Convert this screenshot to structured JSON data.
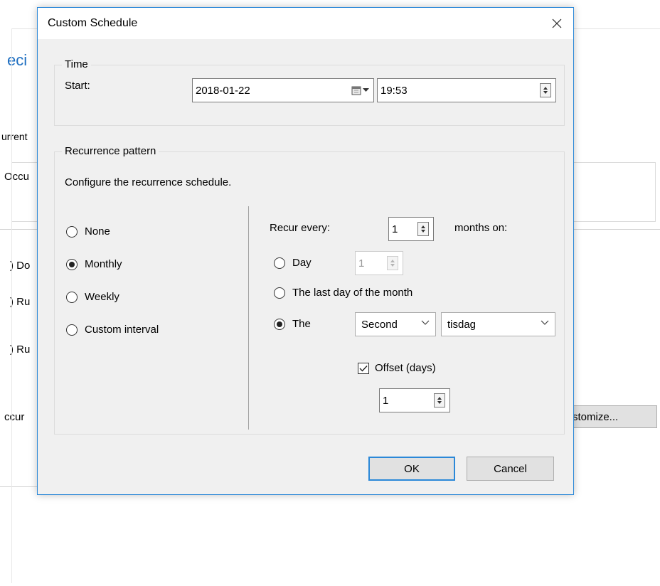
{
  "background": {
    "heading_fragment": "eci",
    "recurrence_fragment": "urrent",
    "occurs_fragment": "Occu",
    "option1": ") Do",
    "option2": ") Ru",
    "option3": ") Ru",
    "occurs_bottom_fragment": "ccur",
    "customize_button": "stomize..."
  },
  "dialog": {
    "title": "Custom Schedule",
    "time": {
      "legend": "Time",
      "start_label": "Start:",
      "date_value": "2018-01-22",
      "time_value": "19:53"
    },
    "recurrence": {
      "legend": "Recurrence pattern",
      "description": "Configure the recurrence schedule.",
      "options": [
        {
          "label": "None",
          "selected": false
        },
        {
          "label": "Monthly",
          "selected": true
        },
        {
          "label": "Weekly",
          "selected": false
        },
        {
          "label": "Custom interval",
          "selected": false
        }
      ],
      "recur_every_label": "Recur every:",
      "recur_every_value": "1",
      "months_on_label": "months on:",
      "day_option_label": "Day",
      "day_value": "1",
      "last_day_label": "The last day of the month",
      "the_label": "The",
      "ordinal_value": "Second",
      "weekday_value": "tisdag",
      "offset_label": "Offset (days)",
      "offset_checked": true,
      "offset_value": "1"
    },
    "ok_label": "OK",
    "cancel_label": "Cancel"
  }
}
